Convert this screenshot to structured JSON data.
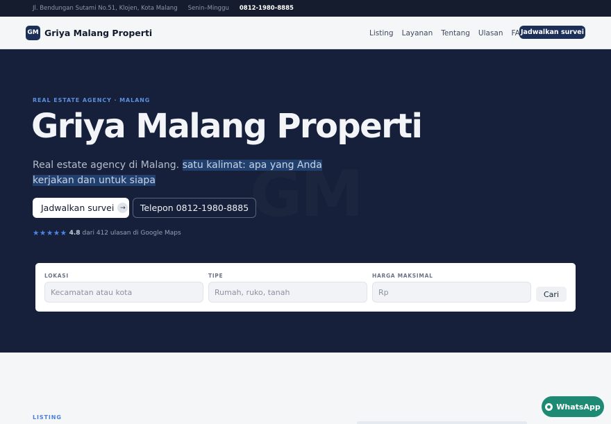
{
  "topbar": {
    "address": "Jl. Bendungan Sutami No.51, Klojen, Kota Malang",
    "hours": "Senin–Minggu",
    "phone": "0812-1980-8885"
  },
  "navbar": {
    "logo_initials": "GM",
    "brand": "Griya Malang Properti",
    "links": [
      "Listing",
      "Layanan",
      "Tentang",
      "Ulasan",
      "FAQ"
    ],
    "cta": "Jadwalkan survei"
  },
  "hero": {
    "eyebrow": "REAL ESTATE AGENCY · MALANG",
    "title": "Griya Malang Properti",
    "subtitle_plain": "Real estate agency di Malang.",
    "subtitle_highlight": "satu kalimat: apa yang Anda kerjakan dan untuk siapa",
    "primary_button": "Jadwalkan survei",
    "secondary_button": "Telepon 0812-1980-8885",
    "watermark": "GM",
    "rating": {
      "stars": "★★★★★",
      "value": "4.8",
      "text": "dari 412 ulasan di Google Maps"
    }
  },
  "search": {
    "location_label": "LOKASI",
    "location_placeholder": "Kecamatan atau kota",
    "type_label": "TIPE",
    "type_placeholder": "Rumah, ruko, tanah",
    "price_label": "HARGA MAKSIMAL",
    "price_placeholder": "Rp",
    "button": "Cari"
  },
  "listing": {
    "section_label": "LISTING"
  },
  "whatsapp": {
    "label": "WhatsApp"
  },
  "colors": {
    "navy": "#16203a",
    "accent_blue": "#4d86e8",
    "brand_badge": "#1b2f58",
    "whatsapp_green": "#1e8a74"
  }
}
